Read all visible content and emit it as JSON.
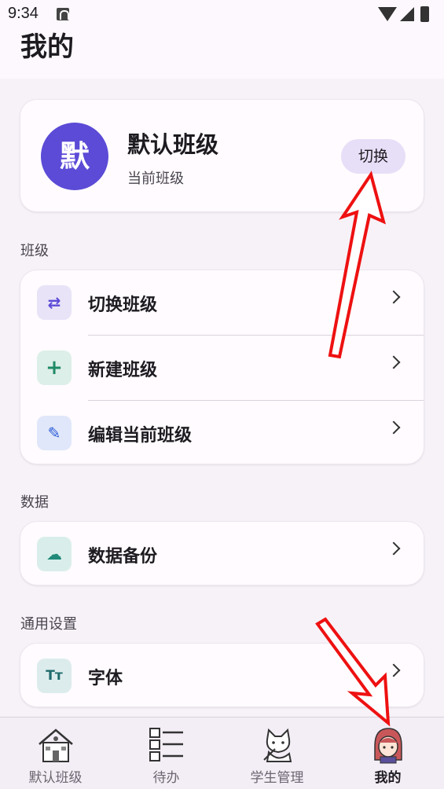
{
  "status": {
    "time": "9:34"
  },
  "header": {
    "title": "我的"
  },
  "class_card": {
    "avatar_text": "默",
    "name": "默认班级",
    "subtitle": "当前班级",
    "switch_label": "切换"
  },
  "sections": {
    "class": {
      "label": "班级",
      "items": [
        {
          "label": "切换班级",
          "icon": "swap-icon"
        },
        {
          "label": "新建班级",
          "icon": "plus-icon"
        },
        {
          "label": "编辑当前班级",
          "icon": "pencil-icon"
        }
      ]
    },
    "data": {
      "label": "数据",
      "items": [
        {
          "label": "数据备份",
          "icon": "cloud-upload-icon"
        }
      ]
    },
    "general": {
      "label": "通用设置",
      "items": [
        {
          "label": "字体",
          "icon": "font-size-icon"
        }
      ]
    }
  },
  "bottom_nav": {
    "items": [
      {
        "label": "默认班级",
        "icon": "school-house-icon",
        "active": false
      },
      {
        "label": "待办",
        "icon": "checklist-icon",
        "active": false
      },
      {
        "label": "学生管理",
        "icon": "cat-student-icon",
        "active": false
      },
      {
        "label": "我的",
        "icon": "girl-avatar-icon",
        "active": true
      }
    ]
  },
  "colors": {
    "accent": "#5b4bd6",
    "annotation_arrow": "#ee1111"
  }
}
